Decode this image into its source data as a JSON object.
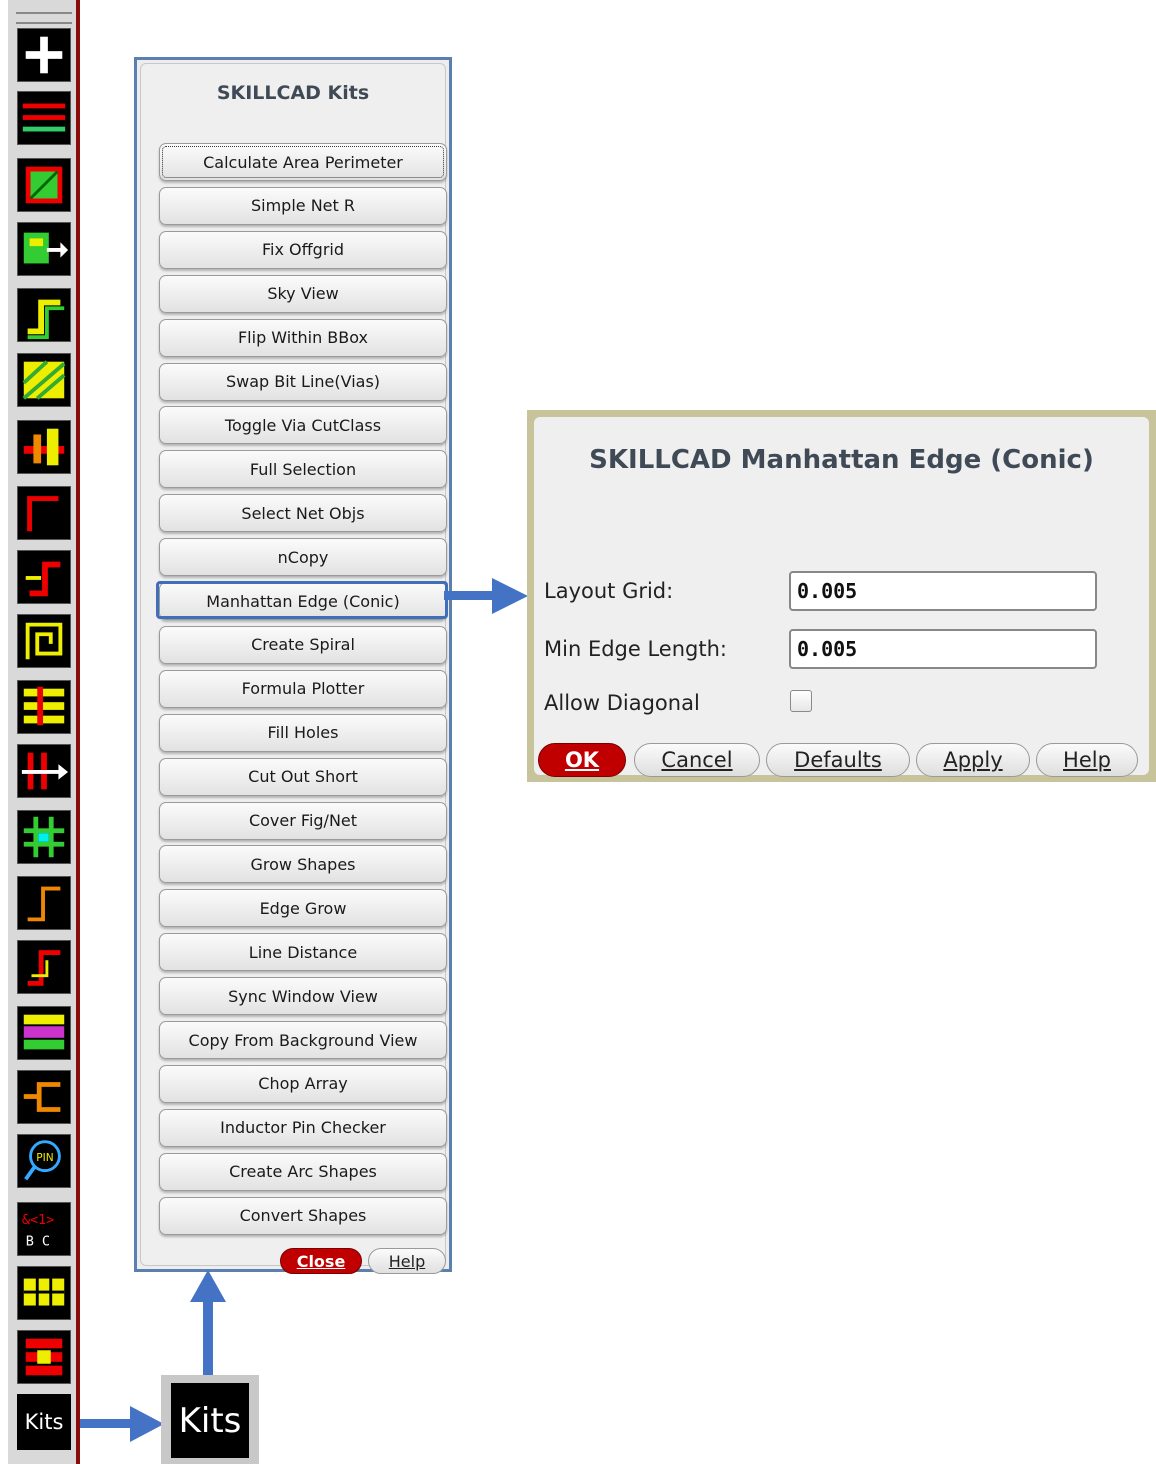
{
  "toolbar": {
    "icons": [
      "add-icon",
      "bus-lines-icon",
      "fill-pattern-icon",
      "move-shape-icon",
      "step-path-icon",
      "hatch-grid-icon",
      "via-stack-icon",
      "corner-path-icon",
      "step-corner-icon",
      "spiral-path-icon",
      "bus-array-icon",
      "cross-bus-icon",
      "grid-cross-icon",
      "corner-wire-icon",
      "step-wire-icon",
      "patterned-layer-icon",
      "bracket-icon",
      "pin-search-icon",
      "pin-label-icon",
      "grid-blocks-icon",
      "array-blocks-icon"
    ],
    "kits_label": "Kits"
  },
  "kits_panel": {
    "title": "SKILLCAD Kits",
    "buttons": [
      "Calculate Area Perimeter",
      "Simple Net R",
      "Fix Offgrid",
      "Sky View",
      "Flip Within BBox",
      "Swap Bit Line(Vias)",
      "Toggle Via CutClass",
      "Full Selection",
      "Select Net Objs",
      "nCopy",
      "Manhattan Edge (Conic)",
      "Create Spiral",
      "Formula Plotter",
      "Fill Holes",
      "Cut Out Short",
      "Cover Fig/Net",
      "Grow Shapes",
      "Edge Grow",
      "Line Distance",
      "Sync Window View",
      "Copy From Background View",
      "Chop Array",
      "Inductor Pin Checker",
      "Create Arc Shapes",
      "Convert Shapes"
    ],
    "highlighted": "Manhattan Edge (Conic)",
    "close_label": "Close",
    "help_label": "Help"
  },
  "kits_zoom": {
    "label": "Kits"
  },
  "dialog": {
    "title": "SKILLCAD Manhattan Edge (Conic)",
    "layout_grid_label": "Layout Grid:",
    "layout_grid_value": "0.005",
    "min_edge_label": "Min Edge Length:",
    "min_edge_value": "0.005",
    "allow_diagonal_label": "Allow Diagonal",
    "allow_diagonal_checked": false,
    "buttons": {
      "ok": "OK",
      "cancel": "Cancel",
      "defaults": "Defaults",
      "apply": "Apply",
      "help": "Help"
    }
  },
  "colors": {
    "accent_blue": "#4472c4",
    "danger_red": "#c00000"
  }
}
